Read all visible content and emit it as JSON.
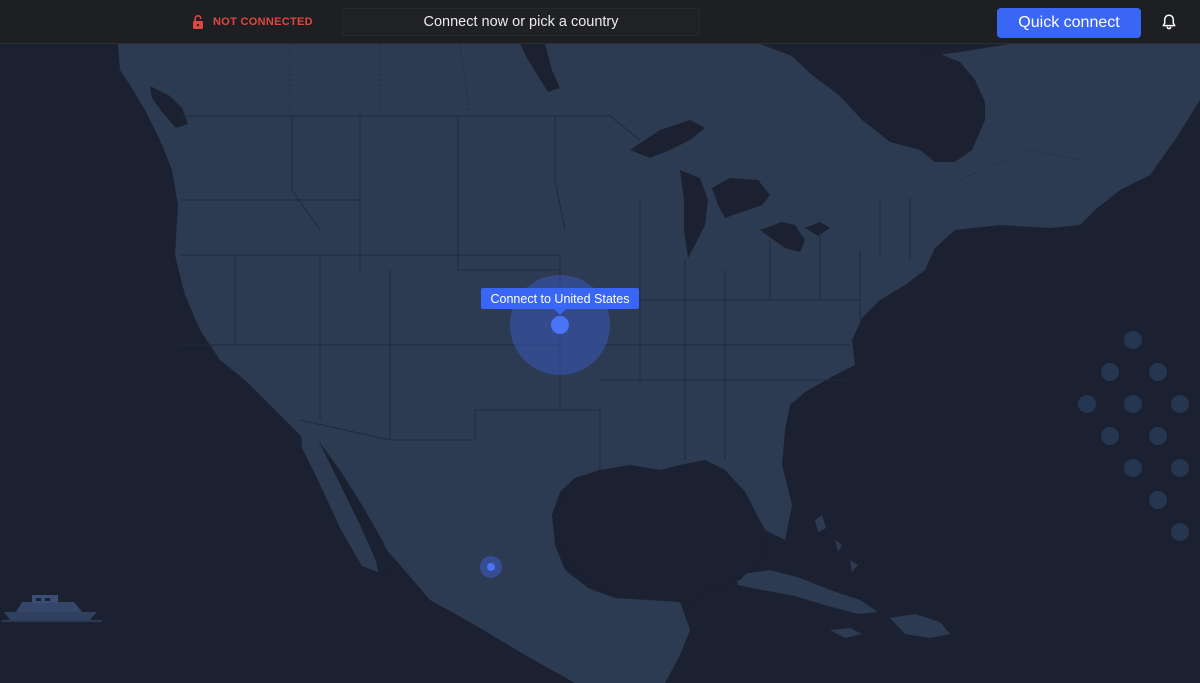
{
  "header": {
    "status_label": "NOT CONNECTED",
    "prompt_text": "Connect now or pick a country",
    "quick_connect_label": "Quick connect",
    "icons": {
      "lock": "lock-open-icon",
      "bell": "bell-icon"
    }
  },
  "map": {
    "tooltip_text": "Connect to United States",
    "markers": [
      "United States",
      "Mexico"
    ]
  },
  "colors": {
    "status_red": "#e0473f",
    "accent_blue": "#3a66f5",
    "ocean": "#1b2130",
    "land": "#2c3b52",
    "topbar": "#1e1f22"
  }
}
